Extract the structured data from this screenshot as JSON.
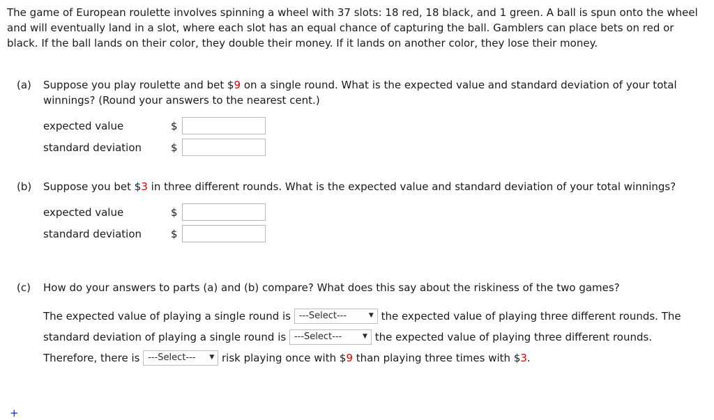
{
  "intro": {
    "text": "The game of European roulette involves spinning a wheel with 37 slots: 18 red, 18 black, and 1 green. A ball is spun onto the wheel and will eventually land in a slot, where each slot has an equal chance of capturing the ball. Gamblers can place bets on red or black. If the ball lands on their color, they double their money. If it lands on another color, they lose their money."
  },
  "parts": {
    "a": {
      "label": "(a)",
      "prompt_before_amount": "Suppose you play roulette and bet ",
      "currency": "$",
      "amount": "9",
      "prompt_after_amount": " on a single round. What is the expected value and standard deviation of your total winnings? (Round your answers to the nearest cent.)",
      "answers": [
        {
          "label": "expected value",
          "currency": "$",
          "value": "",
          "placeholder": ""
        },
        {
          "label": "standard deviation",
          "currency": "$",
          "value": "",
          "placeholder": ""
        }
      ]
    },
    "b": {
      "label": "(b)",
      "prompt_before_amount": "Suppose you bet ",
      "currency": "$",
      "amount": "3",
      "prompt_after_amount": " in three different rounds. What is the expected value and standard deviation of your total winnings?",
      "answers": [
        {
          "label": "expected value",
          "currency": "$",
          "value": "",
          "placeholder": ""
        },
        {
          "label": "standard deviation",
          "currency": "$",
          "value": "",
          "placeholder": ""
        }
      ]
    },
    "c": {
      "label": "(c)",
      "prompt": "How do your answers to parts (a) and (b) compare? What does this say about the riskiness of the two games?",
      "statement": {
        "seg1": "The expected value of playing a single round is ",
        "seg2": " the expected value of playing three different rounds. The standard deviation of playing a single round is ",
        "seg3": " the expected value of playing three different rounds. Therefore, there is ",
        "seg4": " risk playing once with ",
        "currency1": "$",
        "amount1": "9",
        "seg5": " than playing three times with ",
        "currency2": "$",
        "amount2": "3",
        "seg6": "."
      },
      "selects": [
        {
          "name": "expected-value-comparison-select",
          "value": "---Select---",
          "caret": "▼"
        },
        {
          "name": "standard-deviation-comparison-select",
          "value": "---Select---",
          "caret": "▼"
        },
        {
          "name": "risk-comparison-select",
          "value": "---Select---",
          "caret": "▼"
        }
      ]
    }
  },
  "footer": {
    "plus_mark": "+"
  },
  "colors": {
    "text": "#1a1a1a",
    "amount_red": "#dd0000",
    "input_border": "#b9b9b9",
    "select_border": "#bdbdbd",
    "plus_blue": "#1b23c8"
  }
}
